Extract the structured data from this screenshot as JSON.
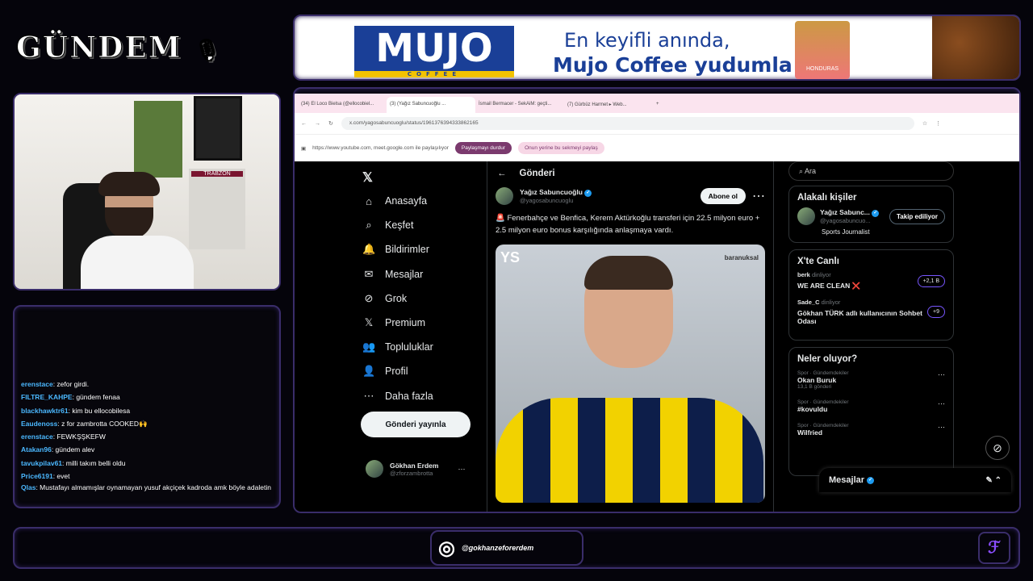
{
  "stream": {
    "logo": "GÜNDEM",
    "instagram": "@gokhanzeforerdem"
  },
  "ad": {
    "brand": "MUJO",
    "brand_sub": "COFFEE",
    "line1": "En keyifli anında,",
    "line2": "Mujo Coffee yudumla!",
    "pack_label": "HONDURAS"
  },
  "cam": {
    "trabzon": "TRABZON"
  },
  "chat": [
    {
      "user": "erenstace",
      "text": ": zefor girdi."
    },
    {
      "user": "FILTRE_KAHPE",
      "text": ": gündem fenaa"
    },
    {
      "user": "blackhawktr61",
      "text": ": kim bu ellocobilesa"
    },
    {
      "user": "Eaudenoss",
      "text": ": z for zambrotta COOKED🙌"
    },
    {
      "user": "erenstace",
      "text": ": FEWKŞŞKEFW"
    },
    {
      "user": "Atakan96",
      "text": ": gündem alev"
    },
    {
      "user": "tavukpilav61",
      "text": ": milli takım belli oldu"
    },
    {
      "user": "Price6191",
      "text": ": evet"
    },
    {
      "user": "Qlas",
      "text": ": Mustafayı almamışlar oynamayan yusuf akçiçek kadroda amk böyle adaletin"
    }
  ],
  "browser": {
    "tabs": [
      "(34) El Loco Bielsa (@ellocobiel...",
      "(3) (Yağız Sabuncuoğlu ...",
      "İsmail Bermacer - SekAiM: geçti...",
      "(7) Gürbüz Harmet ▸ Web...  "
    ],
    "url": "x.com/yagosabuncuoglu/status/1961376394333862165",
    "share_text": "https://www.youtube.com, meet.google.com ile paylaşılıyor",
    "stop_share": "Paylaşmayı durdur",
    "share_this_tab": "Onun yerine bu sekmeyi paylaş"
  },
  "x": {
    "nav": [
      {
        "icon": "⌂",
        "label": "Anasayfa"
      },
      {
        "icon": "⌕",
        "label": "Keşfet"
      },
      {
        "icon": "🔔",
        "label": "Bildirimler"
      },
      {
        "icon": "✉",
        "label": "Mesajlar"
      },
      {
        "icon": "⊘",
        "label": "Grok"
      },
      {
        "icon": "𝕏",
        "label": "Premium"
      },
      {
        "icon": "👥",
        "label": "Topluluklar"
      },
      {
        "icon": "👤",
        "label": "Profil"
      },
      {
        "icon": "⋯",
        "label": "Daha fazla"
      }
    ],
    "post_button": "Gönderi yayınla",
    "me": {
      "name": "Gökhan Erdem",
      "handle": "@zforzambrotta"
    },
    "header": "Gönderi",
    "tweet": {
      "author": "Yağız Sabuncuoğlu",
      "handle": "@yagosabuncuoglu",
      "follow": "Abone ol",
      "text": "🚨 Fenerbahçe ve Benfica, Kerem Aktürkoğlu transferi için 22.5 milyon euro + 2.5 milyon euro bonus karşılığında anlaşmaya vardı.",
      "media_logo": "YS",
      "media_credit": "baranuksal"
    },
    "search_placeholder": "Ara",
    "related": {
      "title": "Alakalı kişiler",
      "name": "Yağız Sabunc...",
      "handle": "@yagosabuncuo...",
      "bio": "Sports Journalist",
      "button": "Takip ediliyor"
    },
    "live": {
      "title": "X'te Canlı",
      "items": [
        {
          "host": "berk",
          "status": "dinliyor",
          "title": "WE ARE CLEAN ❌",
          "count": "+2,1 B"
        },
        {
          "host": "Sade_C",
          "status": "dinliyor",
          "title": "Gökhan TÜRK adlı kullanıcının Sohbet Odası",
          "count": "+9"
        }
      ]
    },
    "trends": {
      "title": "Neler oluyor?",
      "items": [
        {
          "cat": "Spor · Gündemdekiler",
          "name": "Okan Buruk",
          "count": "13,1 B gönderi"
        },
        {
          "cat": "Spor · Gündemdekiler",
          "name": "#kovuldu",
          "count": ""
        },
        {
          "cat": "Spor · Gündemdekiler",
          "name": "Wilfried",
          "count": ""
        }
      ]
    },
    "messages": "Mesajlar"
  },
  "colors": {
    "accent": "#3a2d6a",
    "x_blue": "#1d9bf0",
    "ad_blue": "#1a3f97"
  }
}
